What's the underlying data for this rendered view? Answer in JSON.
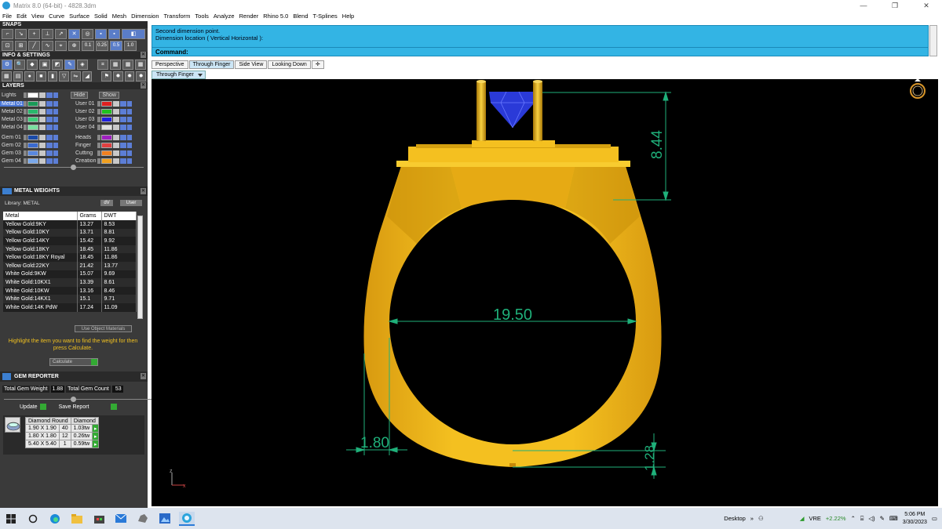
{
  "window": {
    "title": "Matrix 8.0 (64-bit) - 4828.3dm"
  },
  "menu": [
    "File",
    "Edit",
    "View",
    "Curve",
    "Surface",
    "Solid",
    "Mesh",
    "Dimension",
    "Transform",
    "Tools",
    "Analyze",
    "Render",
    "Rhino 5.0",
    "Blend",
    "T-Splines",
    "Help"
  ],
  "snaps": {
    "title": "SNAPS",
    "values": [
      "0.1",
      "0.25",
      "0.5",
      "1.0"
    ]
  },
  "info": {
    "title": "INFO & SETTINGS"
  },
  "layers": {
    "title": "LAYERS",
    "lights": "Lights",
    "hide": "Hide",
    "show": "Show",
    "left": [
      {
        "name": "Metal 01",
        "color": "#1a9a58",
        "selected": true
      },
      {
        "name": "Metal 02",
        "color": "#2ab86c"
      },
      {
        "name": "Metal 03",
        "color": "#3ece7a"
      },
      {
        "name": "Metal 04",
        "color": "#7ae0a0"
      },
      {
        "name": "Gem 01",
        "color": "#1a4aa8"
      },
      {
        "name": "Gem 02",
        "color": "#3a6ad0"
      },
      {
        "name": "Gem 03",
        "color": "#5a88de"
      },
      {
        "name": "Gem 04",
        "color": "#7aa8ea"
      }
    ],
    "right": [
      {
        "name": "User 01",
        "color": "#e02020"
      },
      {
        "name": "User 02",
        "color": "#20c020"
      },
      {
        "name": "User 03",
        "color": "#2020e0"
      },
      {
        "name": "User 04",
        "color": "#e0e0e0"
      },
      {
        "name": "Heads",
        "color": "#a020c0"
      },
      {
        "name": "Finger",
        "color": "#e04040"
      },
      {
        "name": "Cutting",
        "color": "#f08020"
      },
      {
        "name": "Creation",
        "color": "#f0a020"
      }
    ]
  },
  "metal_weights": {
    "title": "METAL WEIGHTS",
    "library": "Library: METAL",
    "btn_dv": "dV",
    "btn_user": "User",
    "headers": [
      "Metal",
      "Grams",
      "DWT"
    ],
    "rows": [
      [
        "Yellow Gold:9KY",
        "13.27",
        "8.53"
      ],
      [
        "Yellow Gold:10KY",
        "13.71",
        "8.81"
      ],
      [
        "Yellow Gold:14KY",
        "15.42",
        "9.92"
      ],
      [
        "Yellow Gold:18KY",
        "18.45",
        "11.86"
      ],
      [
        "Yellow Gold:18KY Royal",
        "18.45",
        "11.86"
      ],
      [
        "Yellow Gold:22KY",
        "21.42",
        "13.77"
      ],
      [
        "White Gold:9KW",
        "15.07",
        "9.69"
      ],
      [
        "White Gold:10KX1",
        "13.39",
        "8.61"
      ],
      [
        "White Gold:10KW",
        "13.16",
        "8.46"
      ],
      [
        "White Gold:14KX1",
        "15.1",
        "9.71"
      ],
      [
        "White Gold:14K PdW",
        "17.24",
        "11.09"
      ]
    ],
    "use_object": "Use Object Materials",
    "hint": "Highlight the item you want to find the weight for then press Calculate.",
    "calculate": "Calculate"
  },
  "gem_reporter": {
    "title": "GEM REPORTER",
    "total_weight_label": "Total Gem Weight",
    "total_weight": "1.88",
    "total_count_label": "Total Gem Count",
    "total_count": "53",
    "update": "Update",
    "save": "Save Report",
    "headers": [
      "Diamond Round",
      "",
      "Diamond"
    ],
    "rows": [
      [
        "1.90 X 1.90",
        "40",
        "1.03tw"
      ],
      [
        "1.80 X 1.80",
        "12",
        "0.26tw"
      ],
      [
        "5.40 X 5.40",
        "1",
        "0.59tw"
      ]
    ]
  },
  "command": {
    "line1": "Second dimension point.",
    "line2": "Dimension location ( Vertical  Horizontal ):",
    "prompt": "Command:"
  },
  "tabs": [
    "Perspective",
    "Through Finger",
    "Side View",
    "Looking Down"
  ],
  "active_tab": "Through Finger",
  "viewport_label": "Through Finger",
  "dimensions": {
    "top": "8.44",
    "width": "19.50",
    "left": "1.80",
    "bottom": "1.28"
  },
  "axis": {
    "z": "z",
    "x": "x"
  },
  "taskbar": {
    "desktop": "Desktop",
    "stock": "VRE",
    "stock_change": "+2.22%",
    "time": "5:06 PM",
    "date": "3/30/2023"
  },
  "colors": {
    "gold": "#f0b418",
    "gold_dark": "#c88a08",
    "dim": "#1fb07a",
    "gem": "#2a3ad8",
    "cmd": "#33b4e4"
  }
}
